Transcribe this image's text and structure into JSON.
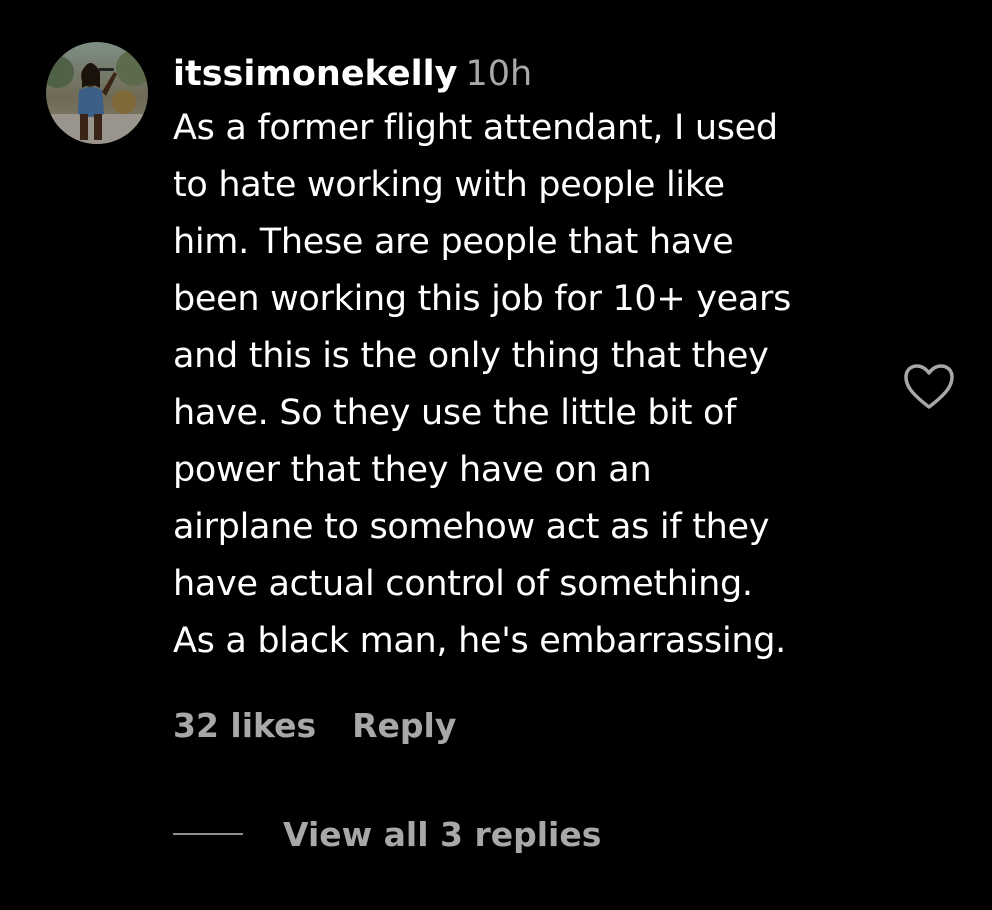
{
  "comment": {
    "username": "itssimonekelly",
    "timestamp": "10h",
    "text": "As a former flight attendant, I used\nto hate working with people like\nhim. These are people that have\nbeen working this job for 10+ years\nand this is the only thing that they\nhave. So they use the little bit of\npower that they have on an\nairplane to somehow act as if they\nhave actual control of something.\nAs a black man, he's embarrassing.",
    "likes": "32 likes",
    "reply_label": "Reply",
    "view_replies": "View all 3 replies",
    "avatar_icon": "profile-photo-performer-with-microphone",
    "like_icon": "heart-outline-icon"
  },
  "colors": {
    "background": "#000000",
    "primary_text": "#ffffff",
    "secondary_text": "#a8a8a8",
    "divider": "#8e8e8e"
  }
}
